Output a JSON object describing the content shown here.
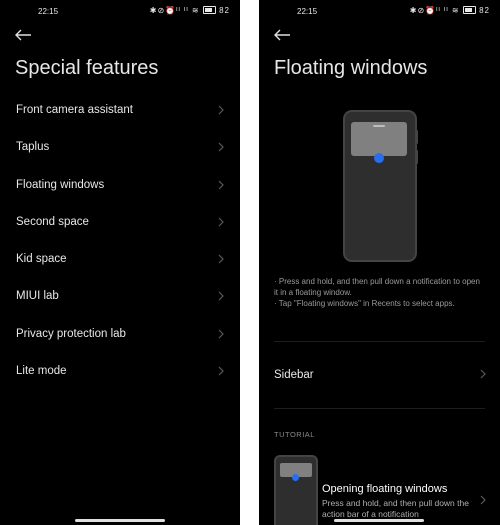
{
  "left": {
    "status": {
      "time": "22:15",
      "icons": "✱⊘⏰ᴵᴵ ᴵᴵ ≋",
      "battery": "82"
    },
    "title": "Special features",
    "items": [
      {
        "label": "Front camera assistant"
      },
      {
        "label": "Taplus"
      },
      {
        "label": "Floating windows"
      },
      {
        "label": "Second space"
      },
      {
        "label": "Kid space"
      },
      {
        "label": "MIUI lab"
      },
      {
        "label": "Privacy protection lab"
      },
      {
        "label": "Lite mode"
      }
    ]
  },
  "right": {
    "status": {
      "time": "22:15",
      "icons": "✱⊘⏰ᴵᴵ ᴵᴵ ≋",
      "battery": "82"
    },
    "title": "Floating windows",
    "description_lines": [
      "· Press and hold, and then pull down a notification to open it in a floating window.",
      "· Tap \"Floating windows\" in Recents to select apps."
    ],
    "sidebar_label": "Sidebar",
    "section_label": "TUTORIAL",
    "tutorial": {
      "title": "Opening floating windows",
      "description": "Press and hold, and then pull down the action bar of a notification"
    }
  },
  "colors": {
    "background": "#000000",
    "accent_blue": "#2a6ef0",
    "text": "#e8e8e8",
    "muted": "#9a9a9a"
  }
}
